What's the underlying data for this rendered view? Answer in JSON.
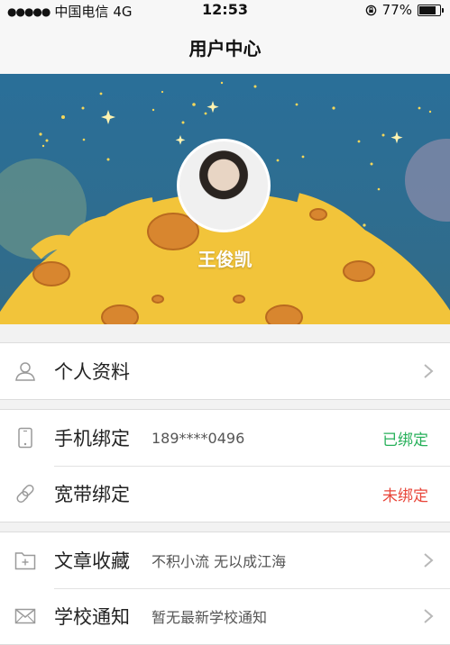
{
  "status_bar": {
    "signal_dots": "●●●●●",
    "carrier": "中国电信",
    "network": "4G",
    "time": "12:53",
    "battery": "77%",
    "battery_level": 0.77
  },
  "nav": {
    "title": "用户中心"
  },
  "profile": {
    "name": "王俊凯"
  },
  "menu": {
    "profile": {
      "label": "个人资料",
      "icon": "person-icon"
    },
    "phone": {
      "label": "手机绑定",
      "detail": "189****0496",
      "status": "已绑定",
      "icon": "phone-icon"
    },
    "broadband": {
      "label": "宽带绑定",
      "status": "未绑定",
      "icon": "link-icon"
    },
    "favorites": {
      "label": "文章收藏",
      "detail": "不积小流 无以成江海",
      "icon": "folder-plus-icon"
    },
    "notices": {
      "label": "学校通知",
      "detail": "暂无最新学校通知",
      "icon": "mail-icon"
    }
  },
  "colors": {
    "bound": "#27b05a",
    "unbound": "#e8463a",
    "banner_sky": "#2a6f99",
    "moon": "#f2c43a"
  }
}
